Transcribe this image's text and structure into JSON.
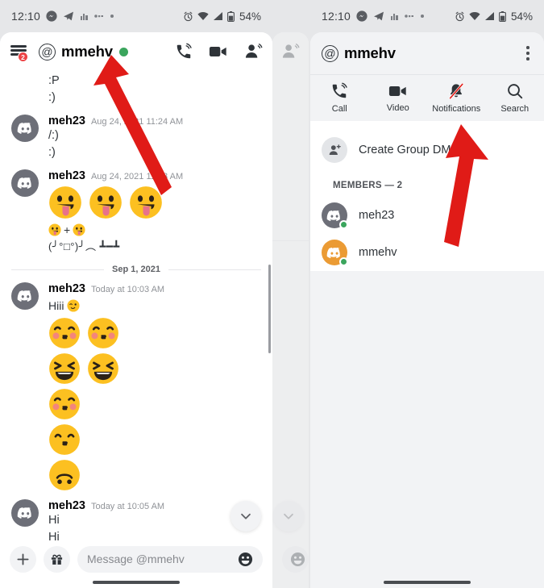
{
  "status_bar": {
    "time": "12:10",
    "battery_percent": "54%",
    "left_icons": [
      "messenger-icon",
      "telegram-icon",
      "app-icon",
      "app-icon-2",
      "dot-icon"
    ],
    "right_icons": [
      "alarm-icon",
      "wifi-icon",
      "signal-icon",
      "battery-icon"
    ]
  },
  "left_panel": {
    "header": {
      "menu_badge": "2",
      "at_symbol": "@",
      "title": "mmehv",
      "presence": "online",
      "actions": [
        "call-icon",
        "video-icon",
        "members-icon"
      ]
    },
    "orphan_lines": [
      ":P",
      ":)"
    ],
    "messages": [
      {
        "author": "meh23",
        "timestamp": "Aug 24, 2021 11:24 AM",
        "avatar": "gray",
        "lines": [
          "/:)",
          ":)"
        ],
        "emoji_row": [],
        "inline": null
      },
      {
        "author": "meh23",
        "timestamp": "Aug 24, 2021 11:33 AM",
        "avatar": "gray",
        "lines": [],
        "emoji_row": [
          "tongue-out-emoji",
          "tongue-out-emoji",
          "tongue-out-emoji"
        ],
        "inline": "(╯°□°)╯︵ ┻━┻"
      },
      {
        "author": "meh23",
        "timestamp": "Today at 10:03 AM",
        "avatar": "gray",
        "lines": [
          "Hiii"
        ],
        "first_line_emoji": "wink-emoji",
        "emoji_stack": [
          [
            "kissing-blush-emoji",
            "kissing-blush-emoji"
          ],
          [
            "laughing-emoji",
            "laughing-emoji"
          ],
          [
            "kissing-blush-emoji"
          ],
          [
            "kissing-smiling-emoji"
          ],
          [
            "upside-down-emoji"
          ]
        ]
      },
      {
        "author": "meh23",
        "timestamp": "Today at 10:05 AM",
        "avatar": "gray",
        "lines": [
          "Hi",
          "Hi"
        ],
        "emoji_row": [],
        "inline": null
      }
    ],
    "date_divider": "Sep 1, 2021",
    "composer": {
      "add_label": "+",
      "gift_icon": "gift-icon",
      "placeholder": "Message @mmehv",
      "emoji_icon": "emoji-icon"
    },
    "jump_to_bottom": "chevron-down-icon"
  },
  "right_panel": {
    "header": {
      "at_symbol": "@",
      "title": "mmehv",
      "overflow": "kebab-menu-icon"
    },
    "actions": [
      {
        "label": "Call",
        "icon": "call-icon"
      },
      {
        "label": "Video",
        "icon": "video-icon"
      },
      {
        "label": "Notifications",
        "icon": "bell-muted-icon"
      },
      {
        "label": "Search",
        "icon": "search-icon"
      }
    ],
    "create_group_dm": "Create Group DM",
    "members_header": "MEMBERS — 2",
    "members": [
      {
        "name": "meh23",
        "avatar": "gray",
        "status": "online"
      },
      {
        "name": "mmehv",
        "avatar": "amber",
        "status": "online"
      }
    ]
  },
  "annotations": {
    "arrow_color": "#e01b17",
    "arrow_1_target": "chat-title",
    "arrow_2_target": "notifications-action"
  }
}
